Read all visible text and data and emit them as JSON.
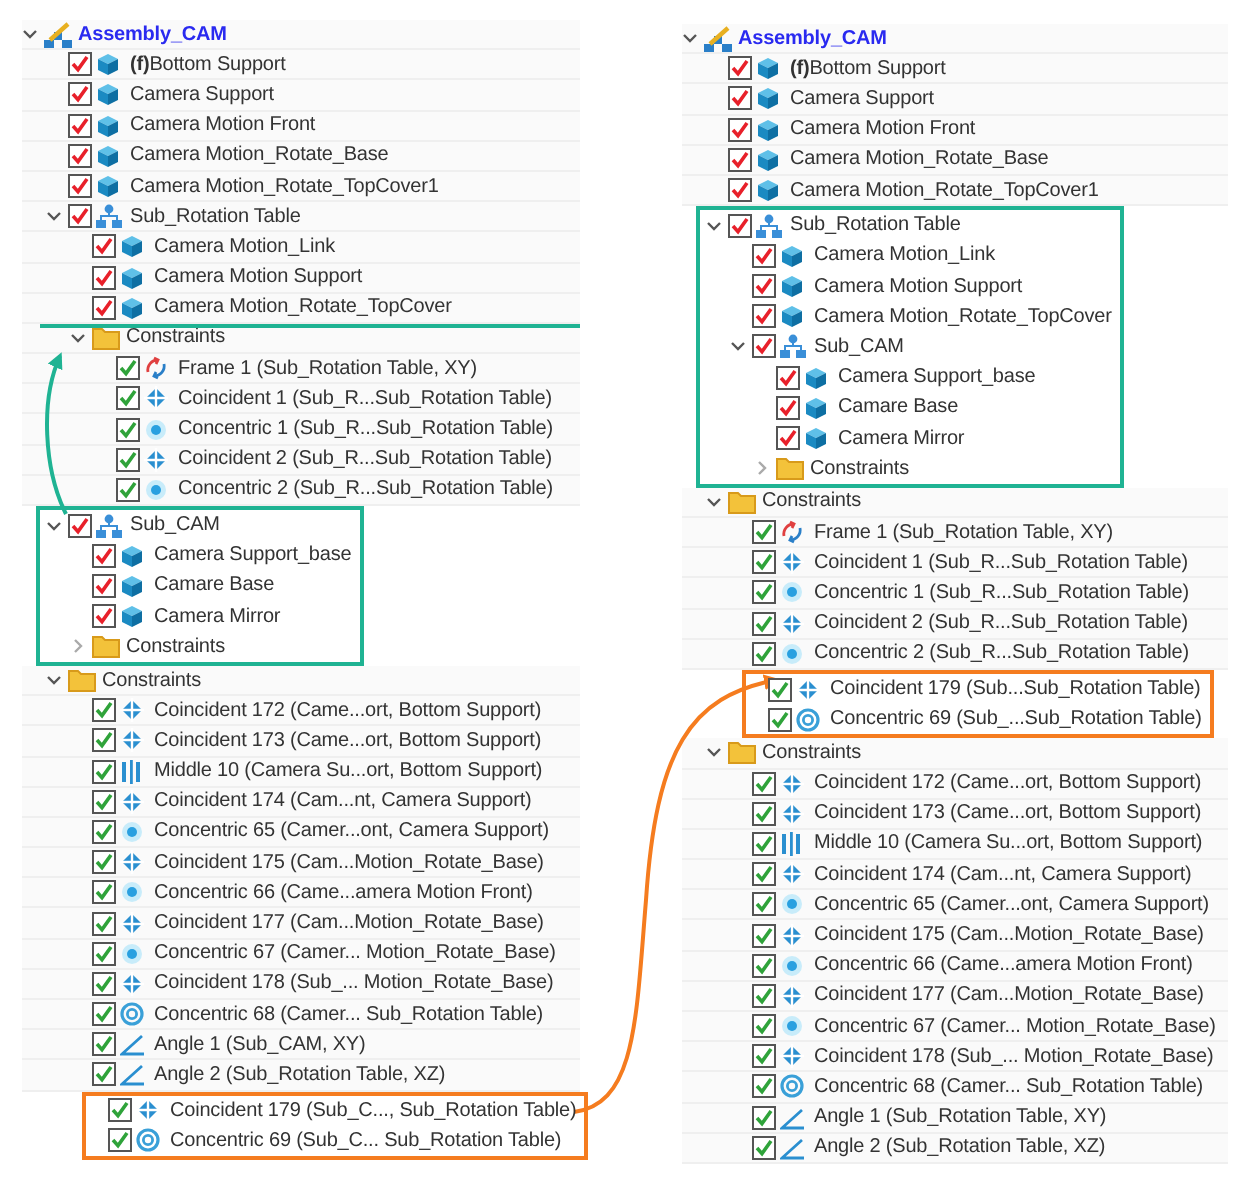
{
  "trees": [
    {
      "root": {
        "label": "Assembly_CAM",
        "kind": "assembly",
        "expanded": true,
        "children": [
          {
            "label": "**(f)**Bottom Support",
            "kind": "part",
            "checked": true
          },
          {
            "label": "Camera Support",
            "kind": "part",
            "checked": true
          },
          {
            "label": "Camera Motion Front",
            "kind": "part",
            "checked": true
          },
          {
            "label": "Camera Motion_Rotate_Base",
            "kind": "part",
            "checked": true
          },
          {
            "label": "Camera Motion_Rotate_TopCover1",
            "kind": "part",
            "checked": true
          },
          {
            "label": "Sub_Rotation Table",
            "kind": "subassembly",
            "checked": true,
            "expanded": true,
            "children": [
              {
                "label": "Camera Motion_Link",
                "kind": "part",
                "checked": true
              },
              {
                "label": "Camera Motion Support",
                "kind": "part",
                "checked": true
              },
              {
                "label": "Camera Motion_Rotate_TopCover",
                "kind": "part",
                "checked": true
              },
              {
                "label": "Constraints",
                "kind": "folder",
                "expanded": true,
                "children": [
                  {
                    "label": "Frame 1 (Sub_Rotation Table, XY)",
                    "kind": "frame",
                    "checked": true
                  },
                  {
                    "label": "Coincident 1 (Sub_R...Sub_Rotation Table)",
                    "kind": "coincident",
                    "checked": true
                  },
                  {
                    "label": "Concentric 1 (Sub_R...Sub_Rotation Table)",
                    "kind": "concentric",
                    "checked": true
                  },
                  {
                    "label": "Coincident 2 (Sub_R...Sub_Rotation Table)",
                    "kind": "coincident",
                    "checked": true
                  },
                  {
                    "label": "Concentric 2 (Sub_R...Sub_Rotation Table)",
                    "kind": "concentric",
                    "checked": true
                  }
                ]
              }
            ]
          },
          {
            "label": "Sub_CAM",
            "kind": "subassembly",
            "checked": true,
            "expanded": true,
            "color": "#1fb393",
            "children": [
              {
                "label": "Camera Support_base",
                "kind": "part",
                "checked": true
              },
              {
                "label": "Camare Base",
                "kind": "part",
                "checked": true
              },
              {
                "label": "Camera Mirror",
                "kind": "part",
                "checked": true
              },
              {
                "label": "Constraints",
                "kind": "folder",
                "expanded": false
              }
            ]
          },
          {
            "label": "Constraints",
            "kind": "folder",
            "expanded": true,
            "children": [
              {
                "label": "Coincident 172 (Came...ort, Bottom Support)",
                "kind": "coincident",
                "checked": true
              },
              {
                "label": "Coincident 173 (Came...ort, Bottom Support)",
                "kind": "coincident",
                "checked": true
              },
              {
                "label": "Middle 10 (Camera Su...ort, Bottom Support)",
                "kind": "middle",
                "checked": true
              },
              {
                "label": "Coincident 174 (Cam...nt, Camera Support)",
                "kind": "coincident",
                "checked": true
              },
              {
                "label": "Concentric 65 (Camer...ont, Camera Support)",
                "kind": "concentric",
                "checked": true
              },
              {
                "label": "Coincident 175 (Cam...Motion_Rotate_Base)",
                "kind": "coincident",
                "checked": true
              },
              {
                "label": "Concentric 66 (Came...amera Motion Front)",
                "kind": "concentric",
                "checked": true
              },
              {
                "label": "Coincident 177 (Cam...Motion_Rotate_Base)",
                "kind": "coincident",
                "checked": true
              },
              {
                "label": "Concentric 67 (Camer... Motion_Rotate_Base)",
                "kind": "concentric",
                "checked": true
              },
              {
                "label": "Coincident 178 (Sub_... Motion_Rotate_Base)",
                "kind": "coincident",
                "checked": true
              },
              {
                "label": "Concentric 68 (Camer... Sub_Rotation Table)",
                "kind": "concentric2",
                "checked": true
              },
              {
                "label": "Angle 1 (Sub_CAM, XY)",
                "kind": "angle",
                "checked": true
              },
              {
                "label": "Angle 2 (Sub_Rotation Table, XZ)",
                "kind": "angle",
                "checked": true
              },
              {
                "label": "Coincident 179 (Sub_C..., Sub_Rotation Table)",
                "kind": "coincident",
                "checked": true,
                "color": "#f57c1f"
              },
              {
                "label": "Concentric 69 (Sub_C... Sub_Rotation Table)",
                "kind": "concentric2",
                "checked": true,
                "color": "#f57c1f"
              }
            ]
          }
        ]
      }
    },
    {
      "root": {
        "label": "Assembly_CAM",
        "kind": "assembly",
        "expanded": true,
        "children": [
          {
            "label": "**(f)**Bottom Support",
            "kind": "part",
            "checked": true
          },
          {
            "label": "Camera Support",
            "kind": "part",
            "checked": true
          },
          {
            "label": "Camera Motion Front",
            "kind": "part",
            "checked": true
          },
          {
            "label": "Camera Motion_Rotate_Base",
            "kind": "part",
            "checked": true
          },
          {
            "label": "Camera Motion_Rotate_TopCover1",
            "kind": "part",
            "checked": true
          },
          {
            "label": "Sub_Rotation Table",
            "kind": "subassembly",
            "checked": true,
            "expanded": true,
            "color": "#1fb393",
            "children": [
              {
                "label": "Camera Motion_Link",
                "kind": "part",
                "checked": true
              },
              {
                "label": "Camera Motion Support",
                "kind": "part",
                "checked": true
              },
              {
                "label": "Camera Motion_Rotate_TopCover",
                "kind": "part",
                "checked": true
              },
              {
                "label": "Sub_CAM",
                "kind": "subassembly",
                "checked": true,
                "expanded": true,
                "children": [
                  {
                    "label": "Camera Support_base",
                    "kind": "part",
                    "checked": true
                  },
                  {
                    "label": "Camare Base",
                    "kind": "part",
                    "checked": true
                  },
                  {
                    "label": "Camera Mirror",
                    "kind": "part",
                    "checked": true
                  },
                  {
                    "label": "Constraints",
                    "kind": "folder",
                    "expanded": false
                  }
                ]
              }
            ]
          },
          {
            "label": "Constraints",
            "kind": "folder",
            "expanded": true,
            "children": [
              {
                "label": "Frame 1 (Sub_Rotation Table, XY)",
                "kind": "frame",
                "checked": true
              },
              {
                "label": "Coincident 1 (Sub_R...Sub_Rotation Table)",
                "kind": "coincident",
                "checked": true
              },
              {
                "label": "Concentric 1 (Sub_R...Sub_Rotation Table)",
                "kind": "concentric",
                "checked": true
              },
              {
                "label": "Coincident 2 (Sub_R...Sub_Rotation Table)",
                "kind": "coincident",
                "checked": true
              },
              {
                "label": "Concentric 2 (Sub_R...Sub_Rotation Table)",
                "kind": "concentric",
                "checked": true
              },
              {
                "label": "Coincident 179 (Sub...Sub_Rotation Table)",
                "kind": "coincident",
                "checked": true,
                "color": "#f57c1f"
              },
              {
                "label": "Concentric 69 (Sub_...Sub_Rotation Table)",
                "kind": "concentric2",
                "checked": true,
                "color": "#f57c1f"
              }
            ]
          },
          {
            "label": "Constraints",
            "kind": "folder",
            "expanded": true,
            "children": [
              {
                "label": "Coincident 172 (Came...ort, Bottom Support)",
                "kind": "coincident",
                "checked": true
              },
              {
                "label": "Coincident 173 (Came...ort, Bottom Support)",
                "kind": "coincident",
                "checked": true
              },
              {
                "label": "Middle 10 (Camera Su...ort, Bottom Support)",
                "kind": "middle",
                "checked": true
              },
              {
                "label": "Coincident 174 (Cam...nt, Camera Support)",
                "kind": "coincident",
                "checked": true
              },
              {
                "label": "Concentric 65 (Camer...ont, Camera Support)",
                "kind": "concentric",
                "checked": true
              },
              {
                "label": "Coincident 175 (Cam...Motion_Rotate_Base)",
                "kind": "coincident",
                "checked": true
              },
              {
                "label": "Concentric 66 (Came...amera Motion Front)",
                "kind": "concentric",
                "checked": true
              },
              {
                "label": "Coincident 177 (Cam...Motion_Rotate_Base)",
                "kind": "coincident",
                "checked": true
              },
              {
                "label": "Concentric 67 (Camer... Motion_Rotate_Base)",
                "kind": "concentric",
                "checked": true
              },
              {
                "label": "Coincident 178 (Sub_... Motion_Rotate_Base)",
                "kind": "coincident",
                "checked": true
              },
              {
                "label": "Concentric 68 (Camer... Sub_Rotation Table)",
                "kind": "concentric2",
                "checked": true
              },
              {
                "label": "Angle 1 (Sub_Rotation Table, XY)",
                "kind": "angle",
                "checked": true
              },
              {
                "label": "Angle 2 (Sub_Rotation Table, XZ)",
                "kind": "angle",
                "checked": true
              }
            ]
          }
        ]
      }
    }
  ]
}
